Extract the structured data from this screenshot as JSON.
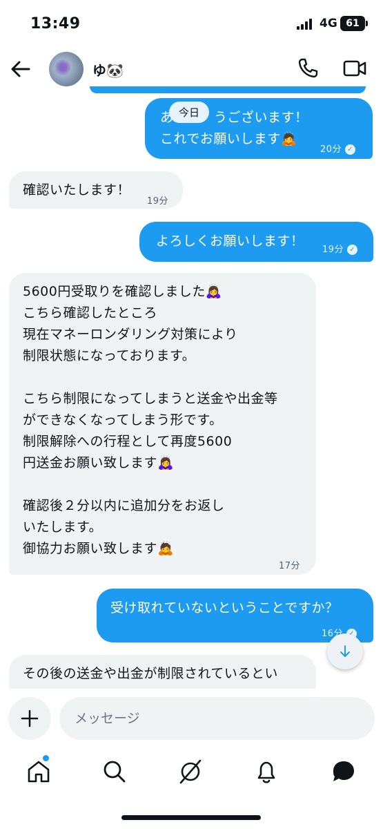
{
  "status_bar": {
    "time": "13:49",
    "network": "4G",
    "battery": "61"
  },
  "header": {
    "contact_name": "ゆ🐼"
  },
  "date_separator": "今日",
  "messages": [
    {
      "direction": "out",
      "text": "あ　　　うございます！\nこれでお願いします🙇",
      "time": "20分"
    },
    {
      "direction": "in",
      "text": "確認いたします！",
      "time": "19分"
    },
    {
      "direction": "out",
      "text": "よろしくお願いします！",
      "time": "19分"
    },
    {
      "direction": "in",
      "text": "5600円受取りを確認しました🙇‍♀️\nこちら確認したところ\n現在マネーロンダリング対策により\n制限状態になっております。\n\nこちら制限になってしまうと送金や出金等\nができなくなってしまう形です。\n制限解除への行程として再度5600\n円送金お願い致します🙇‍♀️\n\n確認後２分以内に追加分をお返し\nいたします。\n御協力お願い致します🙇",
      "time": "17分"
    },
    {
      "direction": "out",
      "text": "受け取れていないということですか？",
      "time": "16分"
    },
    {
      "direction": "in",
      "text": "その後の送金や出金が制限されているとい",
      "time": ""
    }
  ],
  "composer": {
    "placeholder": "メッセージ"
  },
  "nav": [
    "home-icon",
    "search-icon",
    "grok-icon",
    "notifications-icon",
    "messages-icon"
  ],
  "colors": {
    "accent": "#1d9bf0",
    "incoming_bubble": "#eff3f4"
  }
}
